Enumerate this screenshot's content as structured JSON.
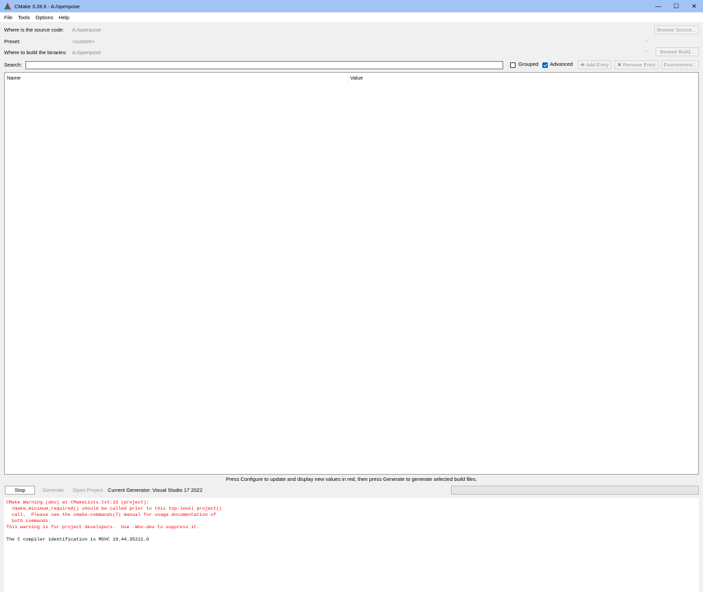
{
  "window": {
    "title": "CMake 3.28.6 - A:/openpose",
    "minimize": "—",
    "maximize": "☐",
    "close": "✕"
  },
  "menu": [
    "File",
    "Tools",
    "Options",
    "Help"
  ],
  "source": {
    "label": "Where is the source code:",
    "value": "A:/openpose",
    "button": "Browse Source..."
  },
  "preset": {
    "label": "Preset:",
    "value": "<custom>"
  },
  "build": {
    "label": "Where to build the binaries:",
    "value": "A:/openpose",
    "button": "Browse Build..."
  },
  "search": {
    "label": "Search:",
    "value": ""
  },
  "options": {
    "grouped": {
      "label": "Grouped",
      "checked": false
    },
    "advanced": {
      "label": "Advanced",
      "checked": true
    },
    "add_entry": "Add Entry",
    "remove_entry": "Remove Entry",
    "environment": "Environment..."
  },
  "table": {
    "columns": [
      "Name",
      "Value"
    ]
  },
  "hint": "Press Configure to update and display new values in red, then press Generate to generate selected build files.",
  "actions": {
    "stop": "Stop",
    "generate": "Generate",
    "open_project": "Open Project",
    "current_generator": "Current Generator: Visual Studio 17 2022"
  },
  "output": {
    "warning_lines": [
      "CMake Warning (dev) at CMakeLists.txt:19 (project):",
      "  cmake_minimum_required() should be called prior to this top-level project()",
      "  call.  Please see the cmake-commands(7) manual for usage documentation of",
      "  both commands.",
      "This warning is for project developers.  Use -Wno-dev to suppress it."
    ],
    "info_lines": [
      "The C compiler identification is MSVC 19.44.35211.0"
    ]
  },
  "colors": {
    "titlebar": "#a2c4f5",
    "warning_text": "#ff0000",
    "checkbox_accent": "#0067c0"
  }
}
